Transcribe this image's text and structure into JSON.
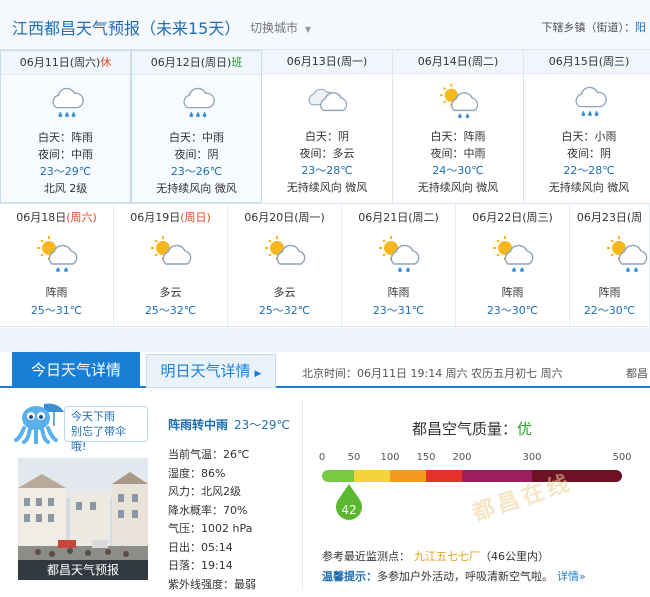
{
  "header": {
    "title": "江西都昌天气预报（未来15天）",
    "switch_city": "切换城市",
    "sub_district_label": "下辖乡镇（街道）：",
    "sub_district_link": "阳"
  },
  "row1": [
    {
      "date": "06月11日",
      "weekday": "(周六)",
      "holiday": "休",
      "holiday_type": "rest",
      "icon": "rain-cloud-icon",
      "day": "白天：阵雨",
      "night": "夜间：中雨",
      "temp": "23～29℃",
      "wind": "北风 2级"
    },
    {
      "date": "06月12日",
      "weekday": "(周日)",
      "holiday": "班",
      "holiday_type": "work",
      "icon": "rain-cloud-icon",
      "day": "白天：中雨",
      "night": "夜间：阴",
      "temp": "23～26℃",
      "wind": "无持续风向 微风"
    },
    {
      "date": "06月13日",
      "weekday": "(周一)",
      "holiday": "",
      "holiday_type": "",
      "icon": "overcast-icon",
      "day": "白天：阴",
      "night": "夜间：多云",
      "temp": "23～28℃",
      "wind": "无持续风向 微风"
    },
    {
      "date": "06月14日",
      "weekday": "(周二)",
      "holiday": "",
      "holiday_type": "",
      "icon": "sun-rain-cloud-icon",
      "day": "白天：阵雨",
      "night": "夜间：中雨",
      "temp": "24～30℃",
      "wind": "无持续风向 微风"
    },
    {
      "date": "06月15日",
      "weekday": "(周三)",
      "holiday": "",
      "holiday_type": "",
      "icon": "rain-cloud-icon",
      "day": "白天：小雨",
      "night": "夜间：阴",
      "temp": "22～28℃",
      "wind": "无持续风向 微风"
    }
  ],
  "row2": [
    {
      "date": "06月18日",
      "weekday": "(周六)",
      "icon": "sun-rain-cloud-icon",
      "weather": "阵雨",
      "temp": "25～31℃"
    },
    {
      "date": "06月19日",
      "weekday": "(周日)",
      "icon": "sun-cloud-icon",
      "weather": "多云",
      "temp": "25～32℃"
    },
    {
      "date": "06月20日",
      "weekday": "(周一)",
      "icon": "sun-cloud-icon",
      "weather": "多云",
      "temp": "25～32℃"
    },
    {
      "date": "06月21日",
      "weekday": "(周二)",
      "icon": "sun-rain-cloud-icon",
      "weather": "阵雨",
      "temp": "23～31℃"
    },
    {
      "date": "06月22日",
      "weekday": "(周三)",
      "icon": "sun-rain-cloud-icon",
      "weather": "阵雨",
      "temp": "23～30℃"
    },
    {
      "date": "06月23日",
      "weekday": "(周",
      "icon": "sun-rain-cloud-icon",
      "weather": "阵雨",
      "temp": "22～30℃"
    }
  ],
  "tabs": {
    "today": "今日天气详情",
    "tomorrow": "明日天气详情",
    "time_info": "北京时间：06月11日 19:14 周六   农历五月初七 周六",
    "time_right": "都昌"
  },
  "today": {
    "bubble_line1": "今天下雨",
    "bubble_line2": "别忘了带伞哦!",
    "photo_caption": "都昌天气预报",
    "summary": "阵雨转中雨",
    "summary_temp": "23～29℃",
    "stats": [
      "当前气温：26℃",
      "湿度：86%",
      "风力：北风2级",
      "降水概率：70%",
      "气压：1002 hPa",
      "日出：05:14",
      "日落：19:14",
      "紫外线强度：最弱"
    ]
  },
  "air": {
    "title": "都昌空气质量：",
    "level": "优",
    "aqi": "42",
    "aqi_value": 42,
    "scale": [
      "0",
      "50",
      "100",
      "150",
      "200",
      "300",
      "500"
    ],
    "scale_values": [
      0,
      50,
      100,
      150,
      200,
      300,
      500
    ],
    "colors": [
      "#7ac943",
      "#f5d33a",
      "#f29a1e",
      "#e4322b",
      "#9b1f5d",
      "#6d1124"
    ],
    "station_label": "参考最近监测点：",
    "station_name": "九江五七七厂",
    "station_distance": "（46公里内）",
    "tip_label": "温馨提示：",
    "tip_text": "多参加户外活动，呼吸清新空气啦。",
    "tip_more": "详情»"
  },
  "watermark": "都昌在线"
}
